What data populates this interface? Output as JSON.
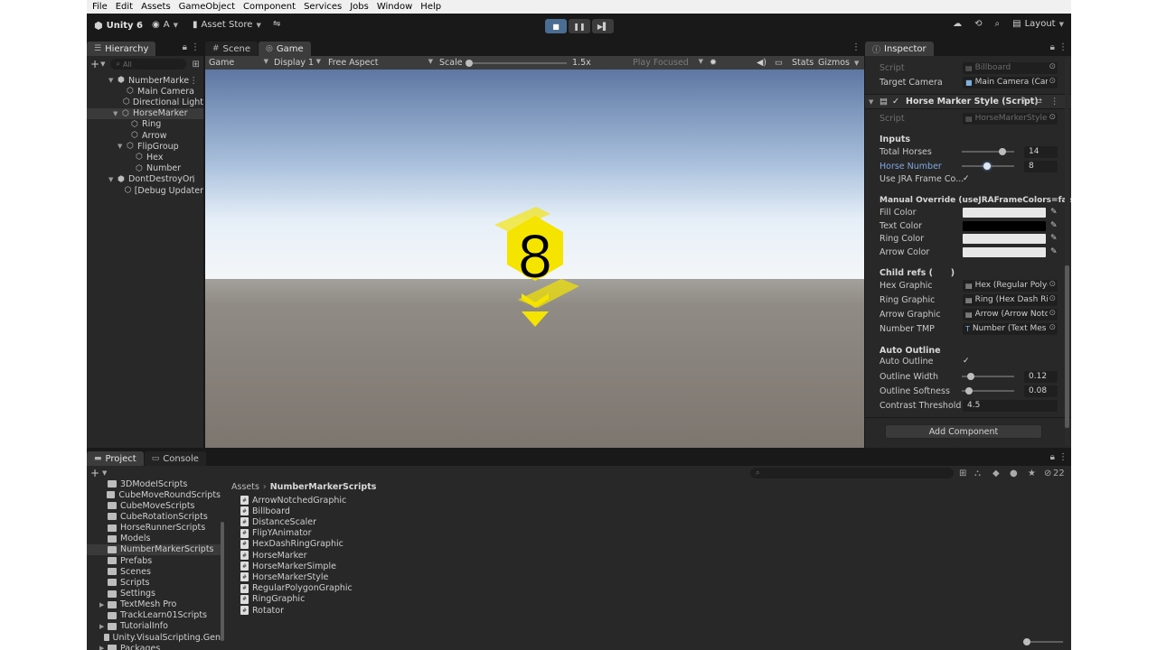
{
  "menu": [
    "File",
    "Edit",
    "Assets",
    "GameObject",
    "Component",
    "Services",
    "Jobs",
    "Window",
    "Help"
  ],
  "toolbar": {
    "unity_label": "Unity 6",
    "account_label": "A",
    "asset_store_label": "Asset Store",
    "layout_label": "Layout"
  },
  "hierarchy": {
    "tab_label": "Hierarchy",
    "search_placeholder": "All",
    "rows": [
      {
        "label": "NumberMarke",
        "indent": 0,
        "fold": "▼",
        "icon": "scene",
        "selected": false
      },
      {
        "label": "Main Camera",
        "indent": 2,
        "fold": "",
        "icon": "cube",
        "selected": false
      },
      {
        "label": "Directional Light",
        "indent": 2,
        "fold": "",
        "icon": "cube",
        "selected": false
      },
      {
        "label": "HorseMarker",
        "indent": 1,
        "fold": "▼",
        "icon": "cube",
        "selected": true
      },
      {
        "label": "Ring",
        "indent": 3,
        "fold": "",
        "icon": "cube",
        "selected": false
      },
      {
        "label": "Arrow",
        "indent": 3,
        "fold": "",
        "icon": "cube",
        "selected": false
      },
      {
        "label": "FlipGroup",
        "indent": 2,
        "fold": "▼",
        "icon": "cube",
        "selected": false
      },
      {
        "label": "Hex",
        "indent": 4,
        "fold": "",
        "icon": "cube",
        "selected": false
      },
      {
        "label": "Number",
        "indent": 4,
        "fold": "",
        "icon": "cube",
        "selected": false
      },
      {
        "label": "DontDestroyOn",
        "indent": 0,
        "fold": "▼",
        "icon": "scene",
        "selected": false
      },
      {
        "label": "[Debug Updater",
        "indent": 2,
        "fold": "",
        "icon": "cube",
        "selected": false
      }
    ]
  },
  "scene_tabs": {
    "scene_label": "Scene",
    "game_label": "Game"
  },
  "game_toolbar": {
    "mode": "Game",
    "display": "Display 1",
    "aspect": "Free Aspect",
    "scale_label": "Scale",
    "scale_value": 0.0,
    "scale_text": "1.5x",
    "play_focused": "Play Focused",
    "stats": "Stats",
    "gizmos": "Gizmos"
  },
  "game": {
    "marker_number": "8",
    "marker_color": "#f4e400"
  },
  "inspector": {
    "tab_label": "Inspector",
    "billboard": {
      "script_label": "Script",
      "script_value": "Billboard",
      "target_camera_label": "Target Camera",
      "target_camera_value": "Main Camera (Cam"
    },
    "component_title": "Horse Marker Style (Script)",
    "script_label": "Script",
    "script_value": "HorseMarkerStyle",
    "inputs_header": "Inputs",
    "total_horses_label": "Total Horses",
    "total_horses_value": "14",
    "total_horses_fraction": 0.82,
    "horse_number_label": "Horse Number",
    "horse_number_value": "8",
    "horse_number_fraction": 0.47,
    "use_jra_label": "Use JRA Frame Co...",
    "manual_header": "Manual Override (useJRAFrameColors=false)",
    "fill_color_label": "Fill Color",
    "fill_color": "#e6e6e6",
    "text_color_label": "Text Color",
    "text_color": "#000000",
    "ring_color_label": "Ring Color",
    "ring_color": "#e6e6e6",
    "arrow_color_label": "Arrow Color",
    "arrow_color": "#e6e6e6",
    "child_refs_header": "Child refs (      )",
    "hex_graphic_label": "Hex Graphic",
    "hex_graphic_value": "Hex (Regular Polyg",
    "ring_graphic_label": "Ring Graphic",
    "ring_graphic_value": "Ring (Hex Dash Rin",
    "arrow_graphic_label": "Arrow Graphic",
    "arrow_graphic_value": "Arrow (Arrow Notc",
    "number_tmp_label": "Number TMP",
    "number_tmp_value": "Number (Text Mes",
    "auto_outline_header": "Auto Outline",
    "auto_outline_label": "Auto Outline",
    "outline_width_label": "Outline Width",
    "outline_width_value": "0.12",
    "outline_width_fraction": 0.12,
    "outline_softness_label": "Outline Softness",
    "outline_softness_value": "0.08",
    "outline_softness_fraction": 0.08,
    "contrast_label": "Contrast Threshold",
    "contrast_value": "4.5",
    "add_component_label": "Add Component"
  },
  "project": {
    "project_tab": "Project",
    "console_tab": "Console",
    "count": "22",
    "breadcrumb_root": "Assets",
    "breadcrumb_current": "NumberMarkerScripts",
    "folders": [
      {
        "label": "3DModelScripts",
        "fold": ""
      },
      {
        "label": "CubeMoveRoundScripts",
        "fold": ""
      },
      {
        "label": "CubeMoveScripts",
        "fold": ""
      },
      {
        "label": "CubeRotationScripts",
        "fold": ""
      },
      {
        "label": "HorseRunnerScripts",
        "fold": ""
      },
      {
        "label": "Models",
        "fold": ""
      },
      {
        "label": "NumberMarkerScripts",
        "fold": "",
        "selected": true
      },
      {
        "label": "Prefabs",
        "fold": ""
      },
      {
        "label": "Scenes",
        "fold": ""
      },
      {
        "label": "Scripts",
        "fold": ""
      },
      {
        "label": "Settings",
        "fold": ""
      },
      {
        "label": "TextMesh Pro",
        "fold": "▶"
      },
      {
        "label": "TrackLearn01Scripts",
        "fold": ""
      },
      {
        "label": "TutorialInfo",
        "fold": "▶"
      },
      {
        "label": "Unity.VisualScripting.Gen",
        "fold": ""
      },
      {
        "label": "Packages",
        "fold": "▶"
      }
    ],
    "files": [
      "ArrowNotchedGraphic",
      "Billboard",
      "DistanceScaler",
      "FlipYAnimator",
      "HexDashRingGraphic",
      "HorseMarker",
      "HorseMarkerSimple",
      "HorseMarkerStyle",
      "RegularPolygonGraphic",
      "RingGraphic",
      "Rotator"
    ]
  }
}
